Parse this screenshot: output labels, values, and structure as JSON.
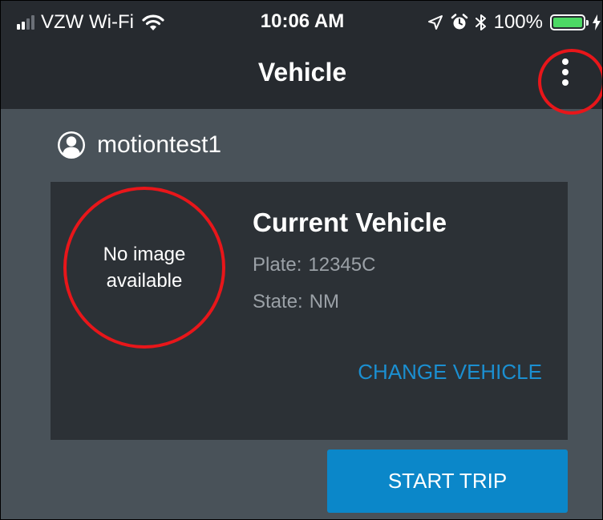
{
  "status_bar": {
    "carrier": "VZW Wi-Fi",
    "time": "10:06 AM",
    "battery": "100%",
    "signal_bars_filled": 2,
    "signal_bars_total": 4,
    "battery_level": 1.0
  },
  "nav": {
    "title": "Vehicle",
    "menu_icon": "more-vertical-icon"
  },
  "account": {
    "icon": "user-circle-icon",
    "username": "motiontest1"
  },
  "vehicle": {
    "image_placeholder": "No image available",
    "title": "Current Vehicle",
    "plate_label": "Plate:",
    "plate": "12345C",
    "state_label": "State:",
    "state": "NM",
    "change_label": "CHANGE VEHICLE"
  },
  "actions": {
    "start_trip_label": "START TRIP"
  },
  "colors": {
    "background": "#495259",
    "bar_background": "#262a2f",
    "card_background": "#2c3136",
    "accent": "#0b87c9",
    "link": "#1b8fd1",
    "annotation_ring": "#e8161a",
    "battery_fill": "#4cd964"
  }
}
